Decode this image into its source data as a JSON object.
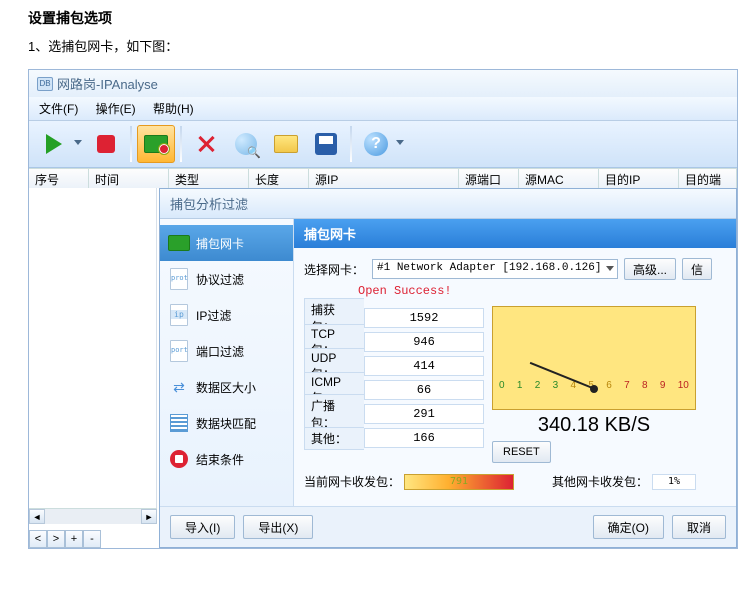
{
  "doc": {
    "heading": "设置捕包选项",
    "step1": "1、选捕包网卡，如下图："
  },
  "app": {
    "icon_text": "DB",
    "title": "网路岗-IPAnalyse"
  },
  "menu": {
    "file": "文件(F)",
    "operate": "操作(E)",
    "help": "帮助(H)"
  },
  "columns": {
    "seq": "序号",
    "time": "时间",
    "type": "类型",
    "length": "长度",
    "src_ip": "源IP",
    "src_port": "源端口",
    "src_mac": "源MAC",
    "dst_ip": "目的IP",
    "dst_port": "目的端"
  },
  "dialog": {
    "title": "捕包分析过滤",
    "footer": {
      "import": "导入(I)",
      "export": "导出(X)",
      "ok": "确定(O)",
      "cancel": "取消"
    }
  },
  "sidebar": {
    "items": [
      {
        "label": "捕包网卡"
      },
      {
        "label": "协议过滤"
      },
      {
        "label": "IP过滤"
      },
      {
        "label": "端口过滤"
      },
      {
        "label": "数据区大小"
      },
      {
        "label": "数据块匹配"
      },
      {
        "label": "结束条件"
      }
    ]
  },
  "panel": {
    "header": "捕包网卡",
    "select_label": "选择网卡：",
    "adapter": "#1 Network Adapter [192.168.0.126]",
    "advanced": "高级...",
    "info": "信",
    "open_success": "Open Success!",
    "stats": {
      "captured": {
        "label": "捕获包：",
        "value": "1592"
      },
      "tcp": {
        "label": "TCP包：",
        "value": "946"
      },
      "udp": {
        "label": "UDP包：",
        "value": "414"
      },
      "icmp": {
        "label": "ICMP包：",
        "value": "66"
      },
      "broadcast": {
        "label": "广播包：",
        "value": "291"
      },
      "other": {
        "label": "其他：",
        "value": "166"
      }
    },
    "gauge": {
      "speed": "340.18 KB/S",
      "reset": "RESET"
    },
    "traffic": {
      "current_label": "当前网卡收发包：",
      "current_value": "791",
      "other_label": "其他网卡收发包：",
      "other_pct": "1%"
    }
  },
  "nav": {
    "left": "<",
    "right": ">",
    "plus": "+",
    "minus": "-"
  }
}
